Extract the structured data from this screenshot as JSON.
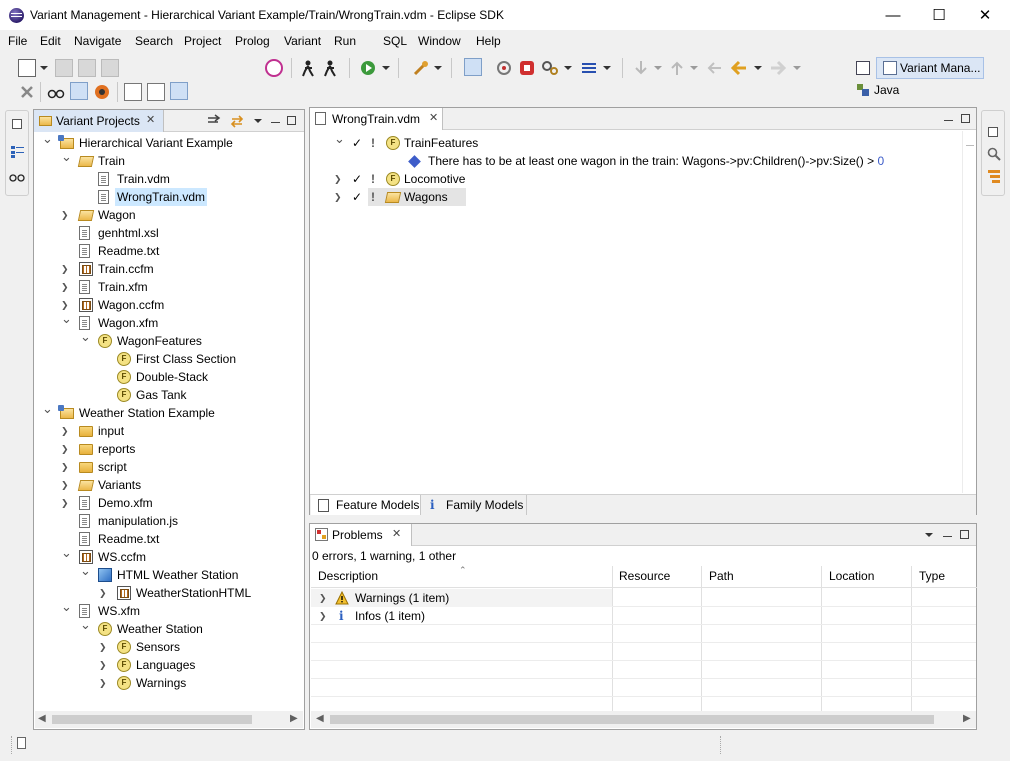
{
  "window": {
    "title": "Variant Management - Hierarchical Variant Example/Train/WrongTrain.vdm - Eclipse SDK",
    "minimize": "—",
    "maximize": "☐",
    "close": "✕"
  },
  "menu": [
    "File",
    "Edit",
    "Navigate",
    "Search",
    "Project",
    "Prolog",
    "Variant",
    "Run",
    "SQL",
    "Window",
    "Help"
  ],
  "perspectives": {
    "active": "Variant Mana...",
    "other": "Java"
  },
  "variant_projects": {
    "tab": "Variant Projects",
    "rows": [
      {
        "label": "Hierarchical Variant Example",
        "indent": 0,
        "twisty": "open",
        "icon": "project"
      },
      {
        "label": "Train",
        "indent": 1,
        "twisty": "open",
        "icon": "folder-open"
      },
      {
        "label": "Train.vdm",
        "indent": 2,
        "twisty": "",
        "icon": "file"
      },
      {
        "label": "WrongTrain.vdm",
        "indent": 2,
        "twisty": "",
        "icon": "file",
        "selected": true
      },
      {
        "label": "Wagon",
        "indent": 1,
        "twisty": "closed",
        "icon": "folder-open"
      },
      {
        "label": "genhtml.xsl",
        "indent": 1,
        "twisty": "",
        "icon": "file"
      },
      {
        "label": "Readme.txt",
        "indent": 1,
        "twisty": "",
        "icon": "file"
      },
      {
        "label": "Train.ccfm",
        "indent": 1,
        "twisty": "closed",
        "icon": "file-model"
      },
      {
        "label": "Train.xfm",
        "indent": 1,
        "twisty": "closed",
        "icon": "file"
      },
      {
        "label": "Wagon.ccfm",
        "indent": 1,
        "twisty": "closed",
        "icon": "file-model"
      },
      {
        "label": "Wagon.xfm",
        "indent": 1,
        "twisty": "open",
        "icon": "file"
      },
      {
        "label": "WagonFeatures",
        "indent": 2,
        "twisty": "open",
        "icon": "feature"
      },
      {
        "label": "First Class Section",
        "indent": 3,
        "twisty": "",
        "icon": "feature"
      },
      {
        "label": "Double-Stack",
        "indent": 3,
        "twisty": "",
        "icon": "feature"
      },
      {
        "label": "Gas Tank",
        "indent": 3,
        "twisty": "",
        "icon": "feature"
      },
      {
        "label": "Weather Station Example",
        "indent": 0,
        "twisty": "open",
        "icon": "project"
      },
      {
        "label": "input",
        "indent": 1,
        "twisty": "closed",
        "icon": "folder"
      },
      {
        "label": "reports",
        "indent": 1,
        "twisty": "closed",
        "icon": "folder"
      },
      {
        "label": "script",
        "indent": 1,
        "twisty": "closed",
        "icon": "folder"
      },
      {
        "label": "Variants",
        "indent": 1,
        "twisty": "closed",
        "icon": "folder-open"
      },
      {
        "label": "Demo.xfm",
        "indent": 1,
        "twisty": "closed",
        "icon": "file"
      },
      {
        "label": "manipulation.js",
        "indent": 1,
        "twisty": "",
        "icon": "file"
      },
      {
        "label": "Readme.txt",
        "indent": 1,
        "twisty": "",
        "icon": "file"
      },
      {
        "label": "WS.ccfm",
        "indent": 1,
        "twisty": "open",
        "icon": "file-model"
      },
      {
        "label": "HTML Weather Station",
        "indent": 2,
        "twisty": "open",
        "icon": "cube"
      },
      {
        "label": "WeatherStationHTML",
        "indent": 3,
        "twisty": "closed",
        "icon": "file-model"
      },
      {
        "label": "WS.xfm",
        "indent": 1,
        "twisty": "open",
        "icon": "file"
      },
      {
        "label": "Weather Station",
        "indent": 2,
        "twisty": "open",
        "icon": "feature"
      },
      {
        "label": "Sensors",
        "indent": 3,
        "twisty": "closed",
        "icon": "feature"
      },
      {
        "label": "Languages",
        "indent": 3,
        "twisty": "closed",
        "icon": "feature"
      },
      {
        "label": "Warnings",
        "indent": 3,
        "twisty": "closed",
        "icon": "feature"
      }
    ]
  },
  "editor": {
    "tab": "WrongTrain.vdm",
    "rows": [
      {
        "label": "TrainFeatures",
        "indent": 0,
        "twisty": "open",
        "check": "✓",
        "excl": "!",
        "icon": "feature"
      },
      {
        "label": "There has to be at least one wagon in the train: Wagons->pv:Children()->pv:Size() > ",
        "num": "0",
        "indent": 1,
        "twisty": "",
        "check": "",
        "excl": "",
        "icon": "diamond"
      },
      {
        "label": "Locomotive",
        "indent": 0,
        "twisty": "closed",
        "check": "✓",
        "excl": "!",
        "icon": "feature"
      },
      {
        "label": "Wagons",
        "indent": 0,
        "twisty": "closed",
        "check": "✓",
        "excl": "!",
        "icon": "folder-open",
        "selected": true
      }
    ],
    "bottom_tabs": [
      "Feature Models",
      "Family Models"
    ]
  },
  "problems": {
    "tab": "Problems",
    "summary": "0 errors, 1 warning, 1 other",
    "columns": [
      "Description",
      "Resource",
      "Path",
      "Location",
      "Type"
    ],
    "rows": [
      {
        "label": "Warnings (1 item)",
        "icon": "warning"
      },
      {
        "label": "Infos (1 item)",
        "icon": "info"
      }
    ]
  },
  "colors": {
    "selection": "#cce8ff",
    "accent": "#3d5cc9"
  }
}
